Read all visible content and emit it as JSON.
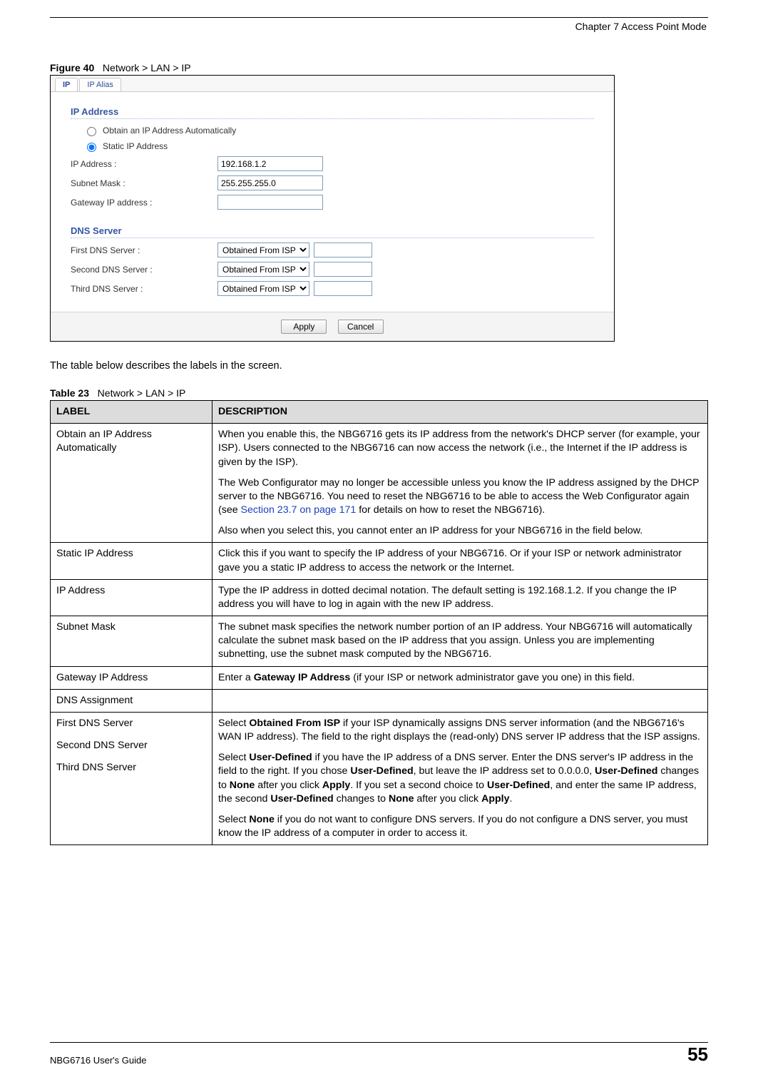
{
  "header": {
    "chapter": "Chapter 7 Access Point Mode"
  },
  "figure": {
    "label": "Figure 40",
    "title": "Network > LAN > IP"
  },
  "screenshot": {
    "tabs": {
      "ip": "IP",
      "ip_alias": "IP Alias"
    },
    "ip_address_section": {
      "title": "IP Address",
      "opt_auto": "Obtain an IP Address Automatically",
      "opt_static": "Static IP Address",
      "ip_label": "IP Address :",
      "ip_value": "192.168.1.2",
      "mask_label": "Subnet Mask :",
      "mask_value": "255.255.255.0",
      "gw_label": "Gateway IP address :",
      "gw_value": ""
    },
    "dns_section": {
      "title": "DNS Server",
      "first": "First DNS Server :",
      "second": "Second DNS Server :",
      "third": "Third DNS Server :",
      "option": "Obtained From ISP"
    },
    "buttons": {
      "apply": "Apply",
      "cancel": "Cancel"
    }
  },
  "intro": "The table below describes the labels in the screen.",
  "table_caption": {
    "label": "Table 23",
    "title": "Network > LAN > IP"
  },
  "table": {
    "header": {
      "label": "LABEL",
      "desc": "DESCRIPTION"
    },
    "rows": {
      "obtain": {
        "label": "Obtain an IP Address Automatically",
        "p1": "When you enable this, the NBG6716 gets its IP address from the network's DHCP server (for example, your ISP). Users connected to the NBG6716 can now access the network (i.e., the Internet if the IP address is given by the ISP).",
        "p2a": "The Web Configurator may no longer be accessible unless you know the IP address assigned by the DHCP server to the NBG6716. You need to reset the NBG6716 to be able to access the Web Configurator again (see ",
        "p2link": "Section 23.7 on page 171",
        "p2b": " for details on how to reset the NBG6716).",
        "p3": "Also when you select this, you cannot enter an IP address for your NBG6716 in the field below."
      },
      "static": {
        "label": "Static IP Address",
        "desc": "Click this if you want to specify the IP address of your NBG6716. Or if your ISP or network administrator gave you a static IP address to access the network or the Internet."
      },
      "ipaddr": {
        "label": "IP Address",
        "desc": "Type the IP address in dotted decimal notation. The default setting is 192.168.1.2. If you change the IP address you will have to log in again with the new IP address."
      },
      "subnet": {
        "label": "Subnet Mask",
        "desc": "The subnet mask specifies the network number portion of an IP address. Your NBG6716 will automatically calculate the subnet mask based on the IP address that you assign. Unless you are implementing subnetting, use the subnet mask computed by the NBG6716."
      },
      "gateway": {
        "label": "Gateway IP Address",
        "pre": "Enter a ",
        "bold": "Gateway IP Address",
        "post": " (if your ISP or network administrator gave you one) in this field."
      },
      "dns_assign": {
        "label": "DNS Assignment"
      },
      "dns": {
        "l1": "First DNS Server",
        "l2": "Second DNS Server",
        "l3": "Third DNS Server",
        "p1a": "Select ",
        "p1b": "Obtained From ISP",
        "p1c": " if your ISP dynamically assigns DNS server information (and the NBG6716's WAN IP address). The field to the right displays the (read-only) DNS server IP address that the ISP assigns.",
        "p2a": "Select ",
        "p2b": "User-Defined",
        "p2c": " if you have the IP address of a DNS server. Enter the DNS server's IP address in the field to the right. If you chose ",
        "p2d": "User-Defined",
        "p2e": ", but leave the IP address set to 0.0.0.0, ",
        "p2f": "User-Defined",
        "p2g": " changes to ",
        "p2h": "None",
        "p2i": " after you click ",
        "p2j": "Apply",
        "p2k": ". If you set a second choice to ",
        "p2l": "User-Defined",
        "p2m": ", and enter the same IP address, the second ",
        "p2n": "User-Defined",
        "p2o": " changes to ",
        "p2p": "None",
        "p2q": " after you click ",
        "p2r": "Apply",
        "p2s": ".",
        "p3a": "Select ",
        "p3b": "None",
        "p3c": " if you do not want to configure DNS servers. If you do not configure a DNS server, you must know the IP address of a computer in order to access it."
      }
    }
  },
  "footer": {
    "guide": "NBG6716 User's Guide",
    "page": "55"
  }
}
